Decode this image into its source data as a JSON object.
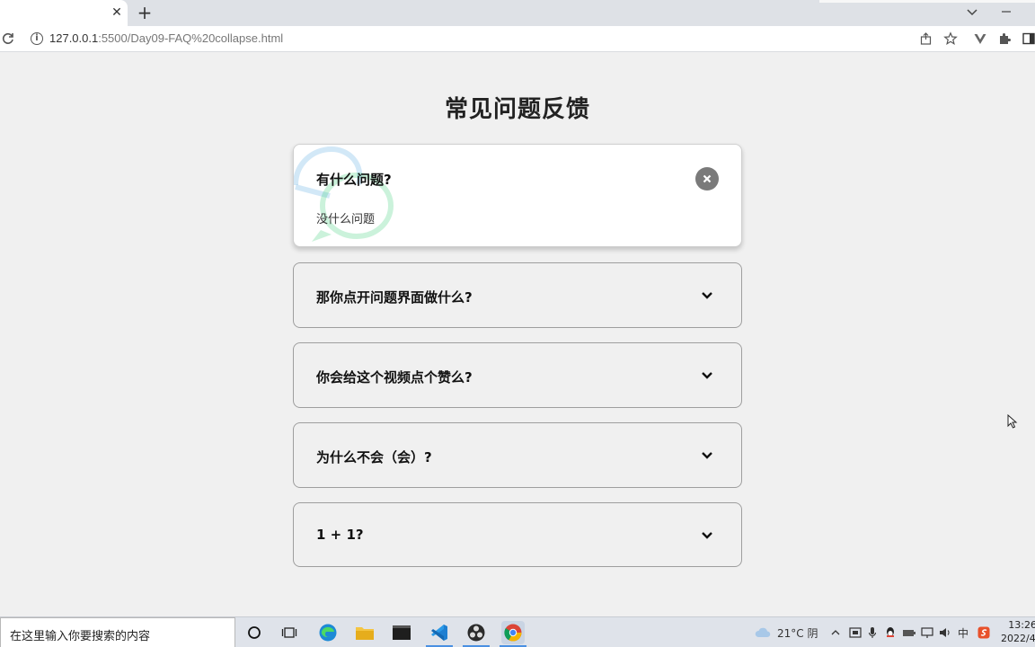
{
  "browser": {
    "tab_close": "✕",
    "new_tab": "+",
    "url_host": "127.0.0.1",
    "url_path": ":5500/Day09-FAQ%20collapse.html"
  },
  "page": {
    "title": "常见问题反馈",
    "faqs": [
      {
        "question": "有什么问题?",
        "answer": "没什么问题",
        "expanded": true
      },
      {
        "question": "那你点开问题界面做什么?",
        "answer": "",
        "expanded": false
      },
      {
        "question": "你会给这个视频点个赞么?",
        "answer": "",
        "expanded": false
      },
      {
        "question": "为什么不会（会）?",
        "answer": "",
        "expanded": false
      },
      {
        "question": "1 + 1?",
        "answer": "",
        "expanded": false
      }
    ],
    "colors": {
      "accent_blue": "#4aa3df",
      "accent_green": "#2ecc71",
      "close_btn": "#7a7a7a"
    }
  },
  "taskbar": {
    "search_placeholder": "在这里输入你要搜索的内容",
    "weather": "21°C 阴",
    "ime": "中",
    "clock_time": "13:26",
    "clock_date": "2022/4/"
  }
}
